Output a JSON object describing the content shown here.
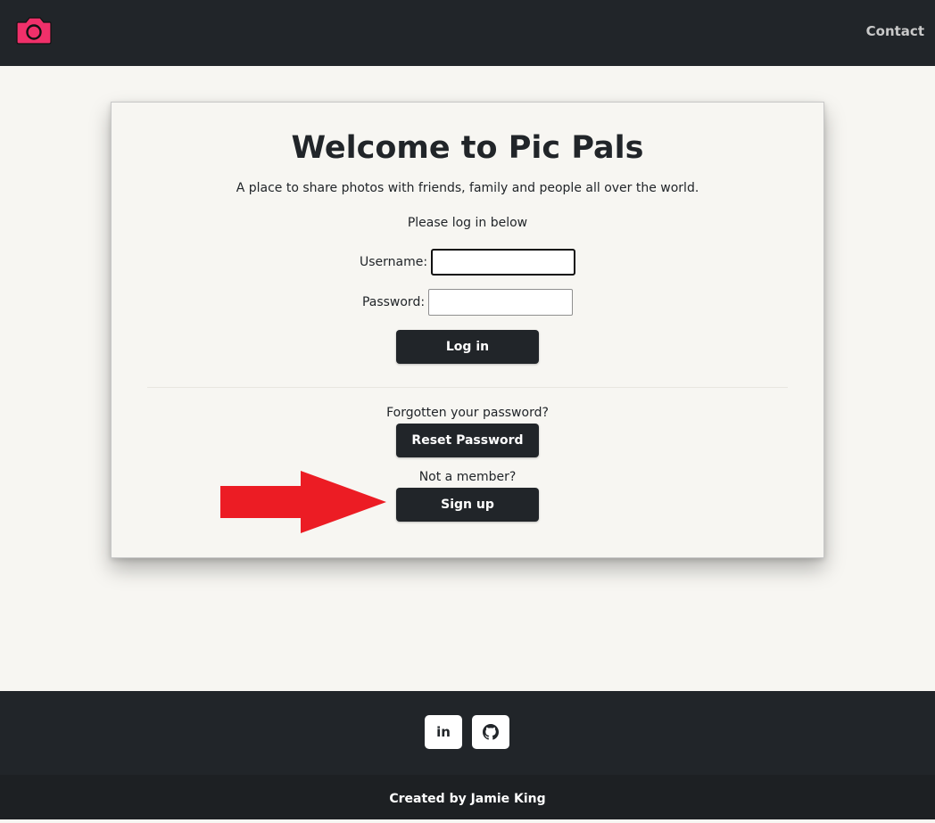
{
  "nav": {
    "contact_label": "Contact",
    "logo_icon": "camera-icon",
    "logo_color": "#f0306a"
  },
  "card": {
    "title": "Welcome to Pic Pals",
    "subtitle": "A place to share photos with friends, family and people all over the world.",
    "prompt": "Please log in below",
    "username_label": "Username:",
    "username_value": "",
    "password_label": "Password:",
    "password_value": "",
    "login_label": "Log in",
    "forgot_text": "Forgotten your password?",
    "reset_label": "Reset Password",
    "member_text": "Not a member?",
    "signup_label": "Sign up"
  },
  "annotation": {
    "arrow_icon": "arrow-right-icon",
    "arrow_color": "#ec1c24"
  },
  "footer": {
    "social": [
      {
        "icon": "linkedin-icon",
        "text": "in"
      },
      {
        "icon": "github-icon"
      }
    ],
    "credit": "Created by Jamie King"
  },
  "colors": {
    "dark": "#212529",
    "background": "#f7f6f2",
    "brand": "#f0306a"
  }
}
